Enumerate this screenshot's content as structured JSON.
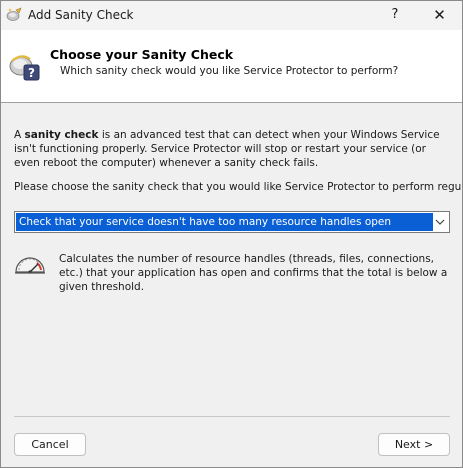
{
  "window": {
    "title": "Add Sanity Check",
    "help_label": "?",
    "close_label": "✕"
  },
  "header": {
    "title": "Choose your Sanity Check",
    "subtitle": "Which sanity check would you like Service Protector to perform?"
  },
  "intro": {
    "prefix": "A ",
    "bold_term": "sanity check",
    "rest": " is an advanced test that can detect when your Windows Service isn't functioning properly. Service Protector will stop or restart your service (or even reboot the computer) whenever a sanity check fails."
  },
  "choose_label": "Please choose the sanity check that you would like Service Protector to perform regularly:",
  "sanity_check_select": {
    "selected": "Check that your service doesn't have too many resource handles open"
  },
  "description": "Calculates the number of resource handles (threads, files, connections, etc.) that your application has open and confirms that the total is below a given threshold.",
  "buttons": {
    "cancel": "Cancel",
    "next": "Next >"
  },
  "icons": {
    "title": "wizard-wand-icon",
    "header": "sanity-check-question-icon",
    "description": "gauge-icon",
    "dropdown": "chevron-down-icon"
  },
  "colors": {
    "selection": "#0a5fd4",
    "header_bg": "#ffffff",
    "window_bg": "#f0f0f0"
  }
}
